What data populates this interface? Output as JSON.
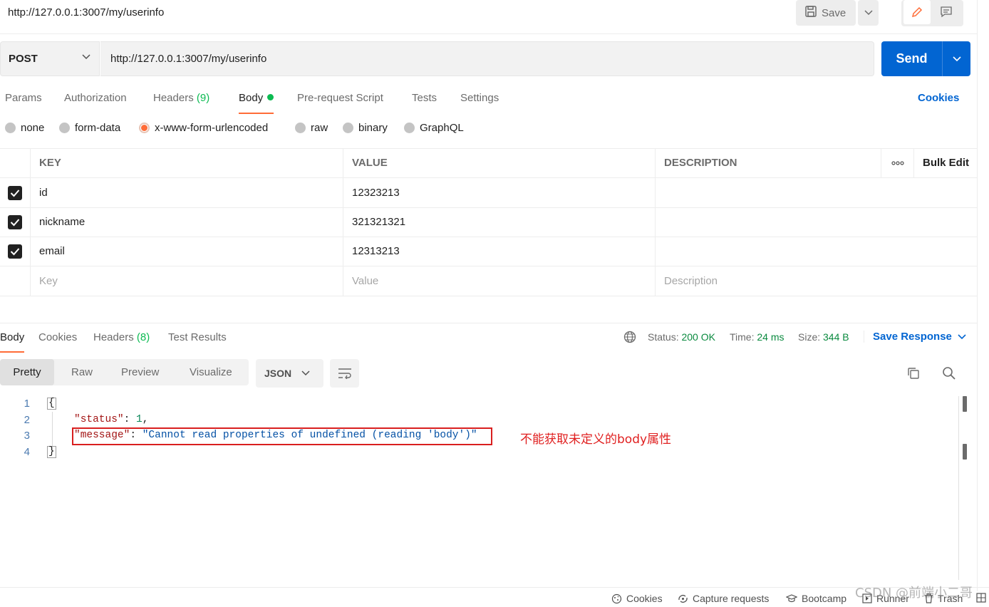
{
  "header": {
    "title": "http://127.0.0.1:3007/my/userinfo",
    "save_label": "Save"
  },
  "request": {
    "method": "POST",
    "url": "http://127.0.0.1:3007/my/userinfo",
    "send_label": "Send"
  },
  "req_tabs": {
    "params": "Params",
    "authorization": "Authorization",
    "headers": "Headers",
    "headers_count": "(9)",
    "body": "Body",
    "prescript": "Pre-request Script",
    "tests": "Tests",
    "settings": "Settings",
    "cookies": "Cookies"
  },
  "body_types": {
    "none": "none",
    "form_data": "form-data",
    "urlencoded": "x-www-form-urlencoded",
    "raw": "raw",
    "binary": "binary",
    "graphql": "GraphQL",
    "selected": "x-www-form-urlencoded"
  },
  "params_table": {
    "headers": {
      "key": "KEY",
      "value": "VALUE",
      "description": "DESCRIPTION",
      "more": "ooo",
      "bulk_edit": "Bulk Edit"
    },
    "rows": [
      {
        "checked": true,
        "key": "id",
        "value": "12323213",
        "description": ""
      },
      {
        "checked": true,
        "key": "nickname",
        "value": "321321321",
        "description": ""
      },
      {
        "checked": true,
        "key": "email",
        "value": "12313213",
        "description": ""
      }
    ],
    "placeholders": {
      "key": "Key",
      "value": "Value",
      "description": "Description"
    }
  },
  "response": {
    "tabs": {
      "body": "Body",
      "cookies": "Cookies",
      "headers": "Headers",
      "headers_count": "(8)",
      "test_results": "Test Results"
    },
    "status_label": "Status:",
    "status_value": "200 OK",
    "time_label": "Time:",
    "time_value": "24 ms",
    "size_label": "Size:",
    "size_value": "344 B",
    "save_response": "Save Response",
    "views": {
      "pretty": "Pretty",
      "raw": "Raw",
      "preview": "Preview",
      "visualize": "Visualize"
    },
    "format": "JSON",
    "code": {
      "open": "{",
      "status_key": "\"status\"",
      "status_value": "1",
      "message_key": "\"message\"",
      "message_value": "\"Cannot read properties of undefined (reading 'body')\"",
      "close": "}",
      "line_numbers": [
        "1",
        "2",
        "3",
        "4"
      ]
    },
    "annotation": "不能获取未定义的body属性"
  },
  "status_bar": {
    "cookies": "Cookies",
    "capture": "Capture requests",
    "bootcamp": "Bootcamp",
    "runner": "Runner",
    "trash": "Trash",
    "watermark": "CSDN @前端小二哥"
  },
  "colors": {
    "accent": "#ff6c37",
    "primary": "#0265d2",
    "success": "#0cbb52",
    "annotation": "#e02020"
  }
}
